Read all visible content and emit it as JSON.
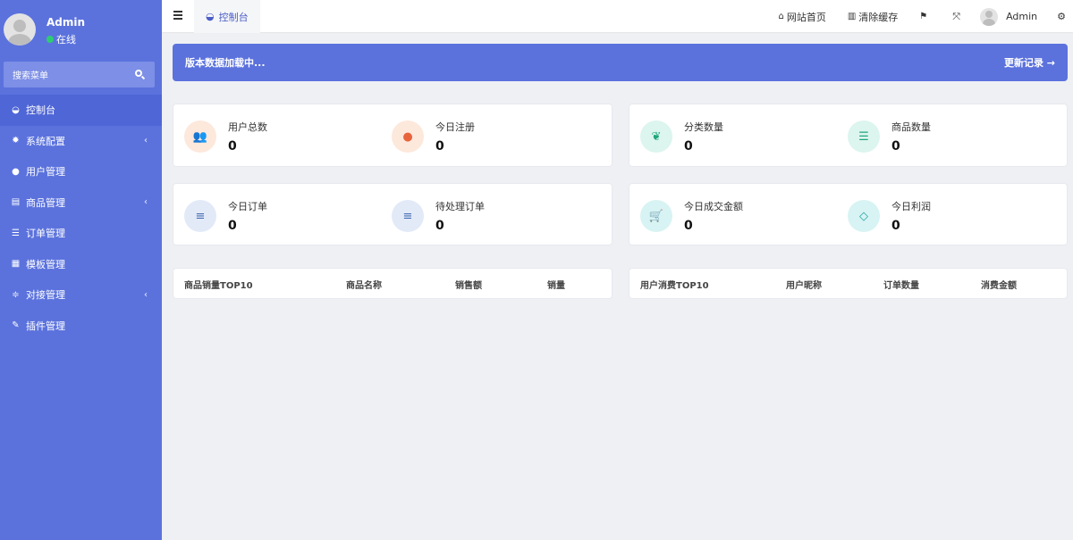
{
  "sidebar": {
    "user": {
      "name": "Admin",
      "status": "在线"
    },
    "search_placeholder": "搜索菜单",
    "items": [
      {
        "label": "控制台",
        "icon": "dashboard-icon",
        "glyph": "◒",
        "active": true,
        "chevron": false
      },
      {
        "label": "系统配置",
        "icon": "gear-icon",
        "glyph": "✹",
        "active": false,
        "chevron": true
      },
      {
        "label": "用户管理",
        "icon": "user-icon",
        "glyph": "●",
        "active": false,
        "chevron": false
      },
      {
        "label": "商品管理",
        "icon": "cart-icon",
        "glyph": "▤",
        "active": false,
        "chevron": true
      },
      {
        "label": "订单管理",
        "icon": "list-icon",
        "glyph": "☰",
        "active": false,
        "chevron": false
      },
      {
        "label": "模板管理",
        "icon": "template-icon",
        "glyph": "▦",
        "active": false,
        "chevron": false
      },
      {
        "label": "对接管理",
        "icon": "sliders-icon",
        "glyph": "≑",
        "active": false,
        "chevron": true
      },
      {
        "label": "插件管理",
        "icon": "plug-icon",
        "glyph": "✎",
        "active": false,
        "chevron": false
      }
    ]
  },
  "topbar": {
    "tab_label": "控制台",
    "home_label": "网站首页",
    "clear_cache_label": "清除缓存",
    "user_name": "Admin"
  },
  "banner": {
    "message": "版本数据加载中...",
    "link_label": "更新记录 →"
  },
  "stats": [
    {
      "label": "用户总数",
      "value": "0",
      "icon": "users-icon",
      "glyph": "👥",
      "bg": "#fde8dc",
      "fg": "#e8643c"
    },
    {
      "label": "今日注册",
      "value": "0",
      "icon": "user-icon",
      "glyph": "●",
      "bg": "#fde8dc",
      "fg": "#e8643c"
    },
    {
      "label": "分类数量",
      "value": "0",
      "icon": "leaf-icon",
      "glyph": "❦",
      "bg": "#dcf5ee",
      "fg": "#21a67a"
    },
    {
      "label": "商品数量",
      "value": "0",
      "icon": "list-icon",
      "glyph": "☰",
      "bg": "#dcf5ee",
      "fg": "#21a67a"
    },
    {
      "label": "今日订单",
      "value": "0",
      "icon": "bars-icon",
      "glyph": "≡",
      "bg": "#e2eaf8",
      "fg": "#4a6fb5"
    },
    {
      "label": "待处理订单",
      "value": "0",
      "icon": "bars-icon",
      "glyph": "≡",
      "bg": "#e2eaf8",
      "fg": "#4a6fb5"
    },
    {
      "label": "今日成交金额",
      "value": "0",
      "icon": "cart-icon",
      "glyph": "🛒",
      "bg": "#d8f3f3",
      "fg": "#1fa5a5"
    },
    {
      "label": "今日利润",
      "value": "0",
      "icon": "diamond-icon",
      "glyph": "◇",
      "bg": "#d8f3f3",
      "fg": "#1fa5a5"
    }
  ],
  "tables": {
    "products": {
      "headers": [
        "商品销量TOP10",
        "商品名称",
        "销售额",
        "销量"
      ]
    },
    "users": {
      "headers": [
        "用户消费TOP10",
        "用户昵称",
        "订单数量",
        "消费金额"
      ]
    }
  }
}
